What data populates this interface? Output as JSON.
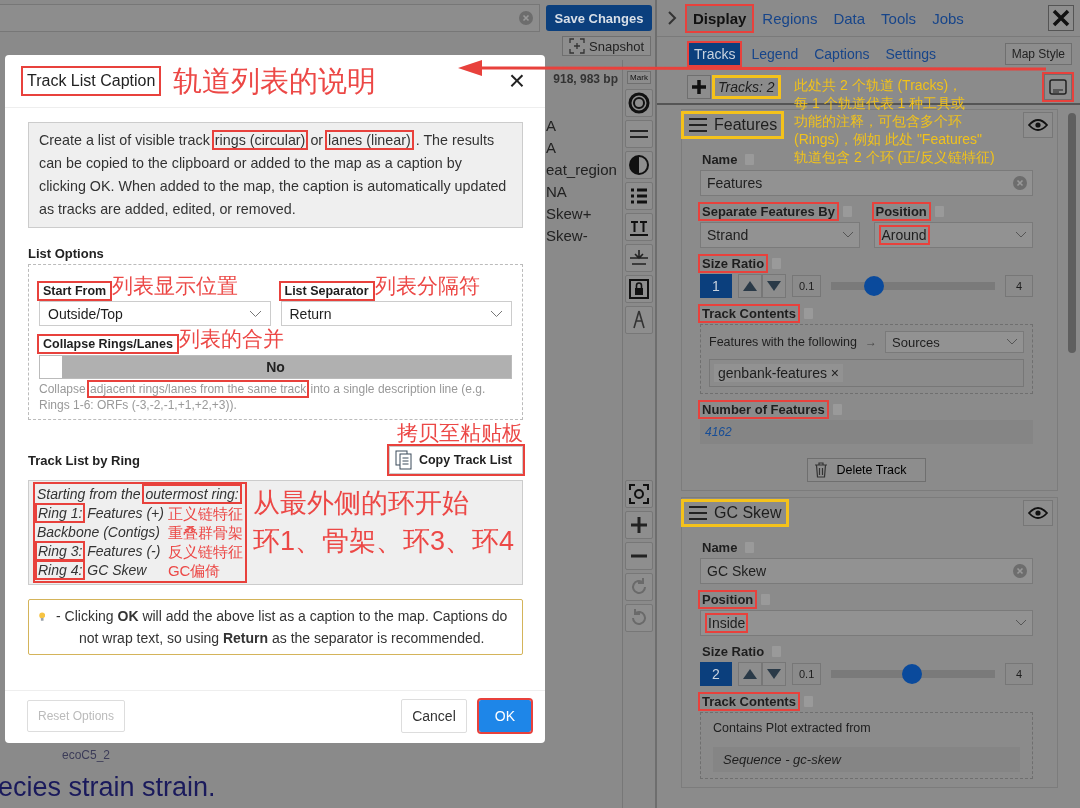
{
  "background_app": {
    "save_button": "Save Changes",
    "snapshot_button": "Snapshot",
    "coordinates": "918, 983 bp",
    "mark_button": "Mark",
    "map_labels": [
      "A",
      "A",
      "eat_region",
      "NA",
      "Skew+",
      "Skew-"
    ],
    "map_small_label": "ecoC5_2",
    "map_title": "ecies strain strain."
  },
  "side_panel": {
    "tabs": [
      {
        "label": "Display",
        "selected": true,
        "boxed": true
      },
      {
        "label": "Regions",
        "selected": false,
        "boxed": false
      },
      {
        "label": "Data",
        "selected": false,
        "boxed": false
      },
      {
        "label": "Tools",
        "selected": false,
        "boxed": false
      },
      {
        "label": "Jobs",
        "selected": false,
        "boxed": false
      }
    ],
    "subtabs": [
      {
        "label": "Tracks",
        "selected": true,
        "boxed": true
      },
      {
        "label": "Legend",
        "selected": false,
        "boxed": false
      },
      {
        "label": "Captions",
        "selected": false,
        "boxed": false
      },
      {
        "label": "Settings",
        "selected": false,
        "boxed": false
      }
    ],
    "map_style_button": "Map Style",
    "track_count": {
      "text": "Tracks: 2",
      "boxed": true
    },
    "caption_button": {
      "boxed": true
    },
    "note_lines": [
      "此处共 2 个轨道 (Tracks)，",
      "每 1 个轨道代表 1 种工具或",
      "功能的注释，可包含多个环",
      "(Rings)，例如 此处 \"Features\"",
      "轨道包含 2 个环 (正/反义链特征)"
    ],
    "tracks": [
      {
        "title": "Features",
        "boxed": true,
        "name_label": "Name",
        "name_value": "Features",
        "selects": [
          {
            "label": "Separate Features By",
            "value": "Strand",
            "boxed": true,
            "value_boxed": false
          },
          {
            "label": "Position",
            "value": "Around",
            "boxed": true,
            "value_boxed": true
          }
        ],
        "size_ratio": {
          "label": "Size Ratio",
          "boxed": true,
          "value": "1",
          "min": "0.1",
          "max": "4",
          "level": 0.23
        },
        "contents": {
          "label": "Track Contents",
          "boxed": true,
          "kind": "features",
          "text": "Features with the following",
          "arrow": "→",
          "select": "Sources",
          "tags": [
            {
              "text": "genbank-features",
              "remove": "×"
            }
          ]
        },
        "count": {
          "label": "Number of Features",
          "boxed": true,
          "value": "4162"
        },
        "delete_button": "Delete Track"
      },
      {
        "title": "GC Skew",
        "boxed": true,
        "name_label": "Name",
        "name_value": "GC Skew",
        "selects": [
          {
            "label": "Position",
            "value": "Inside",
            "boxed": true,
            "value_boxed": true
          }
        ],
        "size_ratio": {
          "label": "Size Ratio",
          "boxed": false,
          "value": "2",
          "min": "0.1",
          "max": "4",
          "level": 0.49
        },
        "contents": {
          "label": "Track Contents",
          "boxed": true,
          "kind": "plot",
          "text": "Contains Plot extracted from",
          "source": "Sequence - gc-skew"
        }
      }
    ]
  },
  "dialog": {
    "title": "Track List Caption",
    "title_boxed": true,
    "title_note": "轨道列表的说明",
    "close": "×",
    "info": [
      {
        "text": "Create a list of visible track",
        "boxed": false
      },
      {
        "text": "rings (circular)",
        "boxed": true
      },
      {
        "text": "or",
        "boxed": false
      },
      {
        "text": "lanes (linear)",
        "boxed": true
      },
      {
        "text": ". The results can be copied to the clipboard or added to the map as a caption by clicking OK. When added to the map, the caption is automatically updated as tracks are added, edited, or removed.",
        "boxed": false
      }
    ],
    "options_heading": "List Options",
    "start_from": {
      "label": "Start From",
      "value": "Outside/Top",
      "boxed": true,
      "note": "列表显示位置"
    },
    "separator": {
      "label": "List Separator",
      "value": "Return",
      "boxed": true,
      "note": "列表分隔符"
    },
    "collapse": {
      "label": "Collapse Rings/Lanes",
      "boxed": true,
      "note": "列表的合并",
      "on": false,
      "state_text": "No",
      "help": [
        {
          "text": "Collapse",
          "boxed": false
        },
        {
          "text": "adjacent rings/lanes from the same track",
          "boxed": true
        },
        {
          "text": "into a single description line (e.g. Rings 1-6: ORFs (-3,-2,-1,+1,+2,+3)).",
          "boxed": false
        }
      ]
    },
    "copy_button": {
      "label": "Copy Track List",
      "boxed": true,
      "note": "拷贝至粘贴板"
    },
    "list_heading": "Track List by Ring",
    "track_list": {
      "boxed": true,
      "side_notes": [
        "从最外侧的环开始",
        "环1、骨架、环3、环4"
      ],
      "lines": [
        {
          "segments": [
            {
              "text": "Starting from the",
              "boxed": false
            },
            {
              "text": "outermost ring:",
              "boxed": true
            }
          ]
        },
        {
          "segments": [
            {
              "text": "Ring 1:",
              "boxed": true
            },
            {
              "text": "Features (+)",
              "boxed": false
            }
          ],
          "note": "正义链特征"
        },
        {
          "segments": [
            {
              "text": "Backbone (Contigs)",
              "boxed": false
            }
          ],
          "note": "重叠群骨架"
        },
        {
          "segments": [
            {
              "text": "Ring 3:",
              "boxed": true
            },
            {
              "text": "Features (-)",
              "boxed": false
            }
          ],
          "note": "反义链特征"
        },
        {
          "segments": [
            {
              "text": "Ring 4:",
              "boxed": true
            },
            {
              "text": "GC Skew",
              "boxed": false
            }
          ],
          "note": "GC偏倚"
        }
      ]
    },
    "tip": "- Clicking **OK** will add the above list as a caption to the map. Captions do not wrap text, so using **Return** as the separator is recommended.",
    "buttons": [
      {
        "label": "Reset Options",
        "kind": "secondary",
        "disabled": true,
        "boxed": false
      },
      {
        "label": "Cancel",
        "kind": "secondary",
        "disabled": false,
        "boxed": false
      },
      {
        "label": "OK",
        "kind": "primary",
        "disabled": false,
        "boxed": true
      }
    ]
  }
}
